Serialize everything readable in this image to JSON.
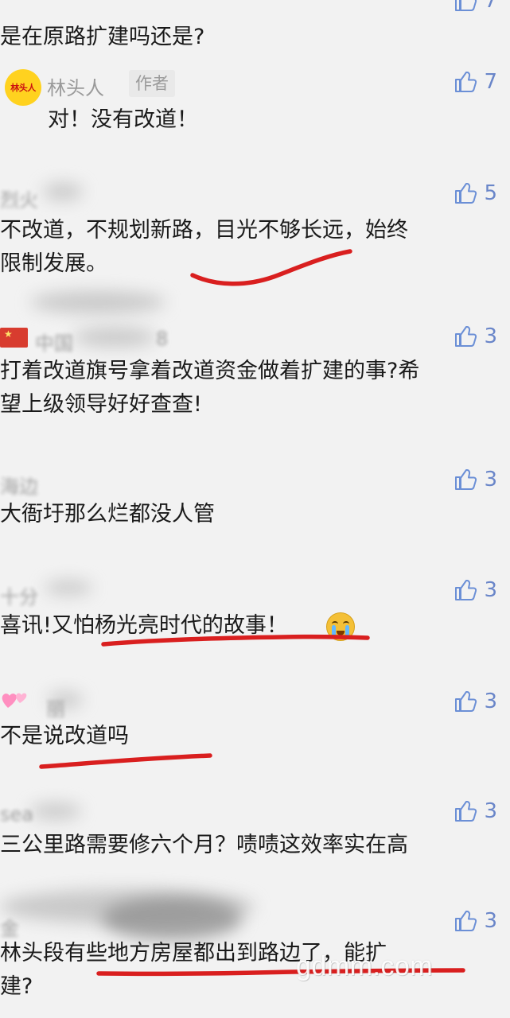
{
  "thread": {
    "top_like_count": "7",
    "top_comment_text": "是在原路扩建吗还是?"
  },
  "comments": [
    {
      "username": "林头人",
      "badge": "作者",
      "avatar_text": "林头人",
      "avatar_icon": "yellow-logo-avatar",
      "likes": "7",
      "text": "对！没有改道！"
    },
    {
      "username": "烈火",
      "likes": "5",
      "text": "不改道，不规划新路，目光不够长远，始终\n限制发展。"
    },
    {
      "username": "中国",
      "username_suffix": "8",
      "flag_icon": "china-flag-icon",
      "likes": "3",
      "text": "打着改道旗号拿着改道资金做着扩建的事?希\n望上级领导好好查查!"
    },
    {
      "username": "海边",
      "likes": "3",
      "text": "大衙圩那么烂都没人管"
    },
    {
      "username": "十分",
      "likes": "3",
      "text": "喜讯!又怕杨光亮时代的故事！"
    },
    {
      "username": "丽",
      "hearts_icon": "pink-hearts-icon",
      "likes": "3",
      "text": "不是说改道吗"
    },
    {
      "username": "sea",
      "likes": "3",
      "text": "三公里路需要修六个月？啧啧这效率实在高"
    },
    {
      "username": "金",
      "likes": "3",
      "text": "林头段有些地方房屋都出到路边了，能扩\n建?"
    }
  ],
  "emoji": {
    "name": "crying-emoji-icon"
  },
  "watermark": {
    "text": "gdmm.com"
  },
  "colors": {
    "background": "#f2f2f2",
    "like_blue": "#6b8fd6",
    "annotation_red": "#d91f1f",
    "avatar_yellow": "#ffd21f"
  }
}
